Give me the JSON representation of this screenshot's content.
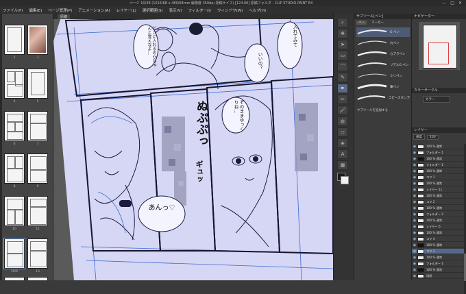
{
  "window": {
    "title": "ページ 10/38 (1015/68 x 480/68mm 解像度 350dpi 原稿サイズ) [124.00] 原稿フォルダ - CLIP STUDIO PAINT EX",
    "controls": [
      "—",
      "□",
      "✕"
    ]
  },
  "menu": [
    "ファイル(F)",
    "編集(E)",
    "ページ管理(P)",
    "アニメーション(A)",
    "レイヤー(L)",
    "選択範囲(S)",
    "表示(V)",
    "フィルター(I)",
    "ウィンドウ(W)",
    "ヘルプ(H)"
  ],
  "canvas_tab": "原稿",
  "pages_panel": {
    "pages": [
      {
        "num": "2"
      },
      {
        "num": "3"
      },
      {
        "num": "4"
      },
      {
        "num": "5"
      },
      {
        "num": "6"
      },
      {
        "num": "7"
      },
      {
        "num": "8"
      },
      {
        "num": "9"
      },
      {
        "num": "10"
      },
      {
        "num": "11"
      },
      {
        "num": "12"
      },
      {
        "num": "13"
      }
    ],
    "selected_label": "10/4"
  },
  "manga": {
    "bubbles": {
      "b1": "どこに入れるのかちゃんと覚えなよ…",
      "b2": "入れてみて",
      "b3": "いいの？",
      "b4": "そのままゆっくりね…",
      "sfx1": "ぬぷぷっ",
      "sfx2": "ギュッ",
      "b5": "あんっ♡"
    }
  },
  "subtool": {
    "header": "サブツール[ペン]",
    "tabs": [
      "ペン",
      "マーカー"
    ],
    "brushes": [
      {
        "label": "G ペン",
        "selected": true
      },
      {
        "label": "丸ペン"
      },
      {
        "label": "カブラペン"
      },
      {
        "label": "リアルG ペン"
      },
      {
        "label": "ミリペン"
      },
      {
        "label": "筆ペン"
      },
      {
        "label": "コピースタンプ"
      }
    ],
    "add_label": "サブツールを追加する"
  },
  "navigator": {
    "header": "ナビゲーター",
    "color_header": "カラーサークル",
    "color_label": "カラー",
    "layer_header": "レイヤー",
    "blend": "通常",
    "opacity": "100"
  },
  "layers": [
    {
      "name": "100 % 通常",
      "type": "plain"
    },
    {
      "name": "フォルダー 1",
      "type": "fold"
    },
    {
      "name": "100 % 通常",
      "type": "black"
    },
    {
      "name": "フォルダー 1",
      "type": "fold"
    },
    {
      "name": "100 % 通常",
      "type": "plain"
    },
    {
      "name": "コマ 1",
      "type": "plain"
    },
    {
      "name": "100 % 通常",
      "type": "plain"
    },
    {
      "name": "レイヤー 11",
      "type": "plain"
    },
    {
      "name": "100 % 通常",
      "type": "plain"
    },
    {
      "name": "コマ 2",
      "type": "plain"
    },
    {
      "name": "100 % 通常",
      "type": "plain"
    },
    {
      "name": "フォルダー 2",
      "type": "fold"
    },
    {
      "name": "100 % 通常",
      "type": "plain"
    },
    {
      "name": "レイヤー 6",
      "type": "plain"
    },
    {
      "name": "100 % 通常",
      "type": "plain"
    },
    {
      "name": "コマ 4",
      "type": "plain"
    },
    {
      "name": "100 % 通常",
      "type": "black"
    },
    {
      "name": "コマ 3",
      "type": "plain",
      "selected": true
    },
    {
      "name": "100 % 通常",
      "type": "plain"
    },
    {
      "name": "フォルダー 1",
      "type": "fold"
    },
    {
      "name": "100 % 通常",
      "type": "black"
    },
    {
      "name": "用紙",
      "type": "plain"
    }
  ],
  "colors": {
    "canvas_paper": "#d6d6f5",
    "line": "#1a1a40",
    "blue_line": "#3a6ad0",
    "mosaic": "#9a9ab8",
    "selection": "#53688c"
  }
}
